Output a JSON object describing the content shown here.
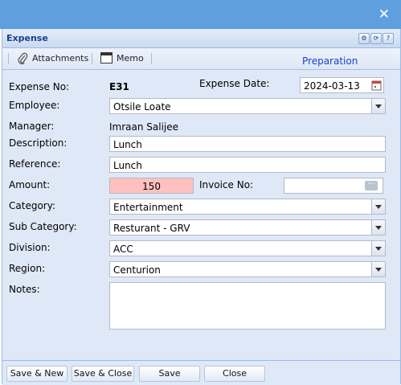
{
  "window": {
    "close_glyph": "✕"
  },
  "header": {
    "title": "Expense",
    "tools": [
      "gear-icon",
      "refresh-icon",
      "help-icon"
    ]
  },
  "toolbar": {
    "attachments_label": "Attachments",
    "memo_label": "Memo",
    "status": "Preparation"
  },
  "form": {
    "expense_no_label": "Expense No:",
    "expense_no": "E31",
    "expense_date_label": "Expense Date:",
    "expense_date": "2024-03-13",
    "employee_label": "Employee:",
    "employee": "Otsile Loate",
    "manager_label": "Manager:",
    "manager": "Imraan Salijee",
    "description_label": "Description:",
    "description": "Lunch",
    "reference_label": "Reference:",
    "reference": "Lunch",
    "amount_label": "Amount:",
    "amount": "150",
    "invoice_no_label": "Invoice No:",
    "invoice_no": "",
    "category_label": "Category:",
    "category": "Entertainment",
    "sub_category_label": "Sub Category:",
    "sub_category": "Resturant - GRV",
    "division_label": "Division:",
    "division": "ACC",
    "region_label": "Region:",
    "region": "Centurion",
    "notes_label": "Notes:",
    "notes": ""
  },
  "footer": {
    "save_new": "Save & New",
    "save_close": "Save & Close",
    "save": "Save",
    "close": "Close"
  },
  "colors": {
    "topbar": "#5f9fe0",
    "status": "#1a3fd0",
    "amount_bg": "#ffc0c0",
    "header_title": "#15428b"
  }
}
